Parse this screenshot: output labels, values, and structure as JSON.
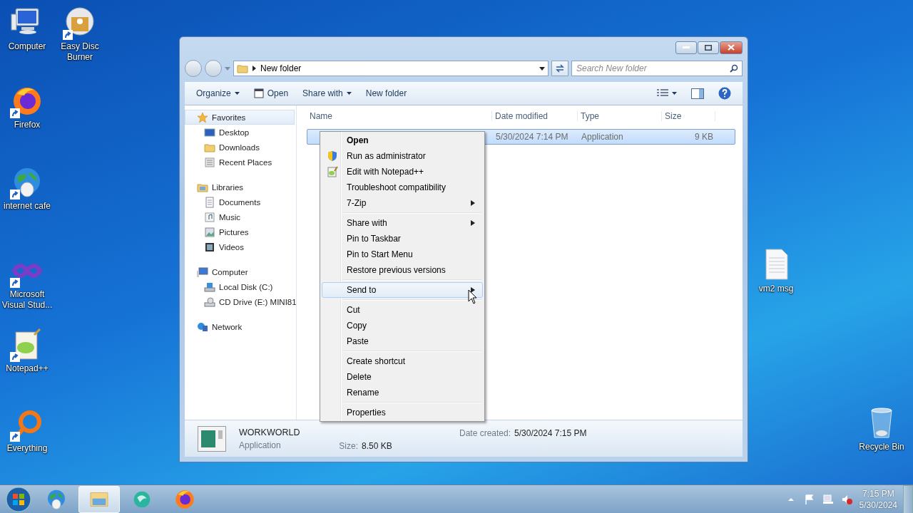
{
  "desktop_icons": [
    {
      "label": "Computer",
      "kind": "computer",
      "shortcut": false
    },
    {
      "label": "Easy Disc Burner",
      "kind": "disc",
      "shortcut": true
    },
    {
      "label": "Firefox",
      "kind": "firefox",
      "shortcut": true
    },
    {
      "label": "internet cafe",
      "kind": "globe",
      "shortcut": true
    },
    {
      "label": "Microsoft Visual Stud...",
      "kind": "infinity",
      "shortcut": true
    },
    {
      "label": "Notepad++",
      "kind": "notepad",
      "shortcut": true
    },
    {
      "label": "Everything",
      "kind": "ring",
      "shortcut": true
    },
    {
      "label": "vm2 msg",
      "kind": "textfile",
      "shortcut": false
    },
    {
      "label": "Recycle Bin",
      "kind": "bin",
      "shortcut": false
    }
  ],
  "window": {
    "address": "New folder",
    "search": {
      "placeholder": "Search New folder"
    },
    "toolbar": [
      {
        "label": "Organize",
        "kind": "dropdown"
      },
      {
        "label": "Open",
        "kind": "open"
      },
      {
        "label": "Share with",
        "kind": "dropdown"
      },
      {
        "label": "New folder",
        "kind": "plain"
      }
    ],
    "sidebar": [
      {
        "label": "Favorites",
        "selected": true,
        "children": [
          {
            "label": "Desktop",
            "selected": false
          },
          {
            "label": "Downloads",
            "selected": false
          },
          {
            "label": "Recent Places",
            "selected": false
          }
        ]
      },
      {
        "label": "Libraries",
        "selected": false,
        "children": [
          {
            "label": "Documents",
            "selected": false
          },
          {
            "label": "Music",
            "selected": false
          },
          {
            "label": "Pictures",
            "selected": false
          },
          {
            "label": "Videos",
            "selected": false
          }
        ]
      },
      {
        "label": "Computer",
        "selected": false,
        "children": [
          {
            "label": "Local Disk (C:)",
            "selected": false
          },
          {
            "label": "CD Drive (E:) MINI81",
            "selected": false
          }
        ]
      },
      {
        "label": "Network",
        "selected": false
      }
    ],
    "columns": [
      "Name",
      "Date modified",
      "Type",
      "Size"
    ],
    "rows": [
      {
        "date_modified": "5/30/2024 7:14 PM",
        "type": "Application",
        "size": "9 KB",
        "selected": true
      }
    ],
    "details": {
      "name": "WORKWORLD",
      "type": "Application",
      "date_created_label": "Date created:",
      "date_created": "5/30/2024 7:15 PM",
      "size_label": "Size:",
      "size": "8.50 KB"
    }
  },
  "context_menu": [
    {
      "kind": "item",
      "label": "Open",
      "default": true,
      "submenu": false,
      "selected": false
    },
    {
      "kind": "item",
      "label": "Run as administrator",
      "default": false,
      "submenu": false,
      "selected": false
    },
    {
      "kind": "item",
      "label": "Edit with Notepad++",
      "default": false,
      "submenu": false,
      "selected": false
    },
    {
      "kind": "item",
      "label": "Troubleshoot compatibility",
      "default": false,
      "submenu": false,
      "selected": false
    },
    {
      "kind": "item",
      "label": "7-Zip",
      "default": false,
      "submenu": true,
      "selected": false
    },
    {
      "kind": "separator"
    },
    {
      "kind": "item",
      "label": "Share with",
      "default": false,
      "submenu": true,
      "selected": false
    },
    {
      "kind": "item",
      "label": "Pin to Taskbar",
      "default": false,
      "submenu": false,
      "selected": false
    },
    {
      "kind": "item",
      "label": "Pin to Start Menu",
      "default": false,
      "submenu": false,
      "selected": false
    },
    {
      "kind": "item",
      "label": "Restore previous versions",
      "default": false,
      "submenu": false,
      "selected": false
    },
    {
      "kind": "separator"
    },
    {
      "kind": "item",
      "label": "Send to",
      "default": false,
      "submenu": true,
      "selected": true
    },
    {
      "kind": "separator"
    },
    {
      "kind": "item",
      "label": "Cut",
      "default": false,
      "submenu": false,
      "selected": false
    },
    {
      "kind": "item",
      "label": "Copy",
      "default": false,
      "submenu": false,
      "selected": false
    },
    {
      "kind": "item",
      "label": "Paste",
      "default": false,
      "submenu": false,
      "selected": false
    },
    {
      "kind": "separator"
    },
    {
      "kind": "item",
      "label": "Create shortcut",
      "default": false,
      "submenu": false,
      "selected": false
    },
    {
      "kind": "item",
      "label": "Delete",
      "default": false,
      "submenu": false,
      "selected": false
    },
    {
      "kind": "item",
      "label": "Rename",
      "default": false,
      "submenu": false,
      "selected": false
    },
    {
      "kind": "separator"
    },
    {
      "kind": "item",
      "label": "Properties",
      "default": false,
      "submenu": false,
      "selected": false
    }
  ],
  "taskbar": {
    "apps": [
      {
        "kind": "globe",
        "selected": false
      },
      {
        "kind": "explorer",
        "selected": true
      },
      {
        "kind": "chat",
        "selected": false
      },
      {
        "kind": "firefox",
        "selected": false
      }
    ],
    "time": "7:15 PM",
    "date": "5/30/2024"
  }
}
